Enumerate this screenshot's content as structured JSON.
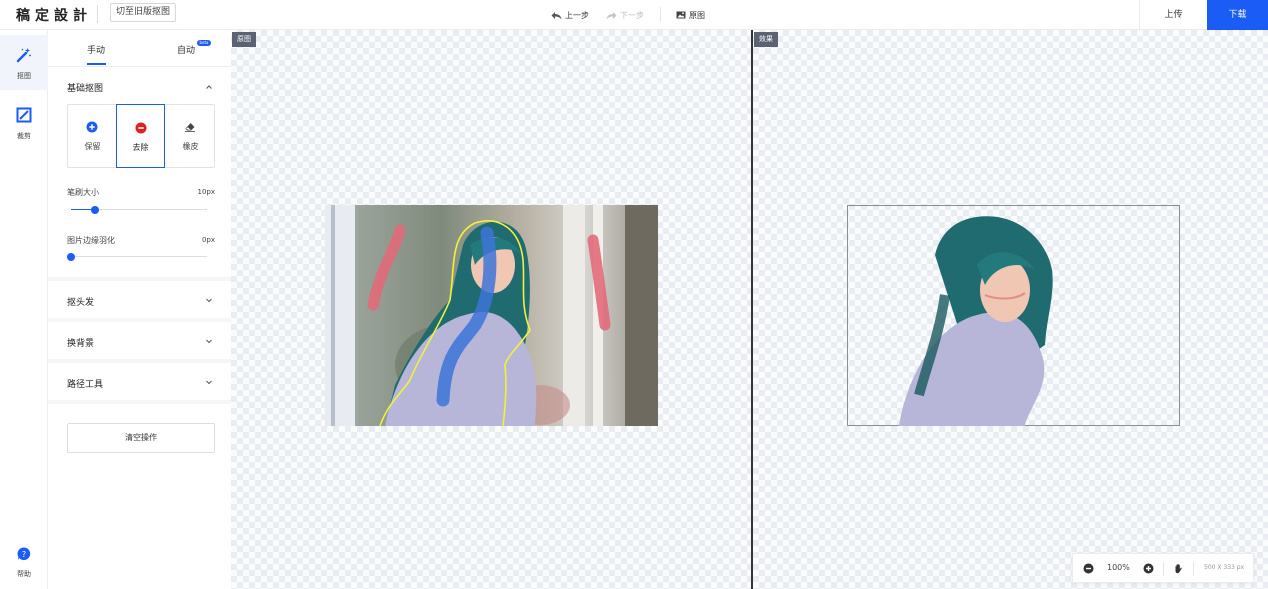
{
  "header": {
    "logo": "稿定設計",
    "switch_label": "切至旧版抠图",
    "undo_label": "上一步",
    "redo_label": "下一步",
    "original_label": "原图",
    "upload_label": "上传",
    "download_label": "下载"
  },
  "rail": {
    "items": [
      {
        "label": "抠图",
        "icon": "magic-wand-icon"
      },
      {
        "label": "裁剪",
        "icon": "crop-icon"
      },
      {
        "label": "帮助",
        "icon": "help-icon"
      }
    ]
  },
  "panel": {
    "tabs": [
      {
        "label": "手动"
      },
      {
        "label": "自动"
      }
    ],
    "beta_badge": "beta",
    "basic_section": "基础抠图",
    "tools": [
      {
        "label": "保留",
        "icon": "plus-circle-icon"
      },
      {
        "label": "去除",
        "icon": "minus-circle-icon"
      },
      {
        "label": "橡皮",
        "icon": "eraser-icon"
      }
    ],
    "brush_size": {
      "label": "笔刷大小",
      "value": "10px",
      "fraction": 0.18
    },
    "feather": {
      "label": "图片边缘羽化",
      "value": "0px",
      "fraction": 0
    },
    "sections": [
      {
        "label": "抠头发"
      },
      {
        "label": "换背景"
      },
      {
        "label": "路径工具"
      }
    ],
    "clear_label": "清空操作"
  },
  "canvas": {
    "left_tag": "原图",
    "right_tag": "效果"
  },
  "zoom": {
    "value": "100%",
    "dims": "500 X 333 px"
  },
  "colors": {
    "accent": "#1a5cf5",
    "remove_red": "#e02020"
  }
}
